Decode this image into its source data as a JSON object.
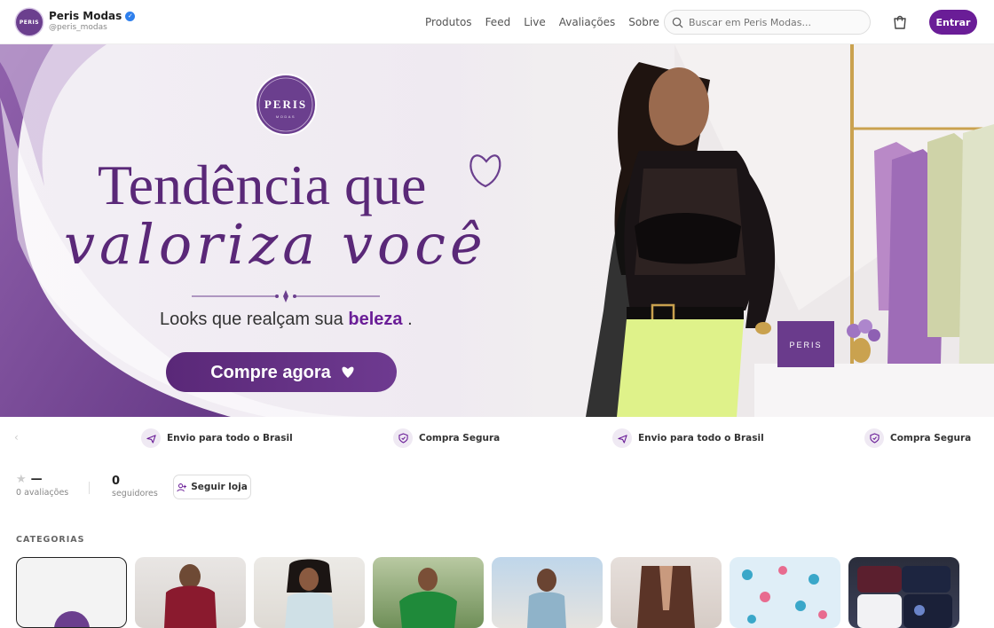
{
  "header": {
    "store_name": "Peris Modas",
    "handle": "@peris_modas",
    "avatar_text": "PERIS",
    "nav": [
      "Produtos",
      "Feed",
      "Live",
      "Avaliações",
      "Sobre"
    ],
    "search_placeholder": "Buscar em Peris Modas...",
    "login_label": "Entrar"
  },
  "banner": {
    "logo_text": "PERIS",
    "logo_sub": "MODAS",
    "headline": "Tendência que",
    "script": "valoriza você",
    "tagline_pre": "Looks que realçam sua",
    "tagline_bold": "beleza",
    "tagline_post": ".",
    "cta": "Compre agora",
    "box_label": "PERIS"
  },
  "features": [
    "Envio para todo o Brasil",
    "Compra Segura",
    "Envio para todo o Brasil",
    "Compra Segura"
  ],
  "stats": {
    "rating_value": "—",
    "rating_label": "0 avaliações",
    "followers_value": "0",
    "followers_label": "seguidores",
    "follow_button": "Seguir loja"
  },
  "categories": {
    "title": "CATEGORIAS",
    "count_visible": 8
  },
  "colors": {
    "brand": "#6a1d97",
    "banner_purple": "#6b3f8e",
    "verified": "#2f80ed"
  }
}
